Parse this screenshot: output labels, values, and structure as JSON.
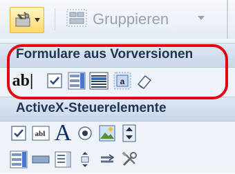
{
  "toolbar": {
    "group_label": "Gruppieren"
  },
  "legacy_section": {
    "title": "Formulare aus Vorversionen",
    "text_field_label": "ab|",
    "controls": [
      "text-field",
      "checkbox",
      "combo-box",
      "list-box",
      "option-group",
      "eraser"
    ]
  },
  "activex_section": {
    "title": "ActiveX-Steuerelemente",
    "row1": [
      "checkbox",
      "textbox",
      "label",
      "option-button",
      "image",
      "spin-button"
    ],
    "label_text": "A",
    "row2": [
      "combo-box",
      "command-button",
      "list-box",
      "toggle-button",
      "scrollbar",
      "more-controls"
    ]
  },
  "colors": {
    "highlight": "#e30613",
    "header_text": "#1f3552",
    "accent": "#ffd76a"
  }
}
